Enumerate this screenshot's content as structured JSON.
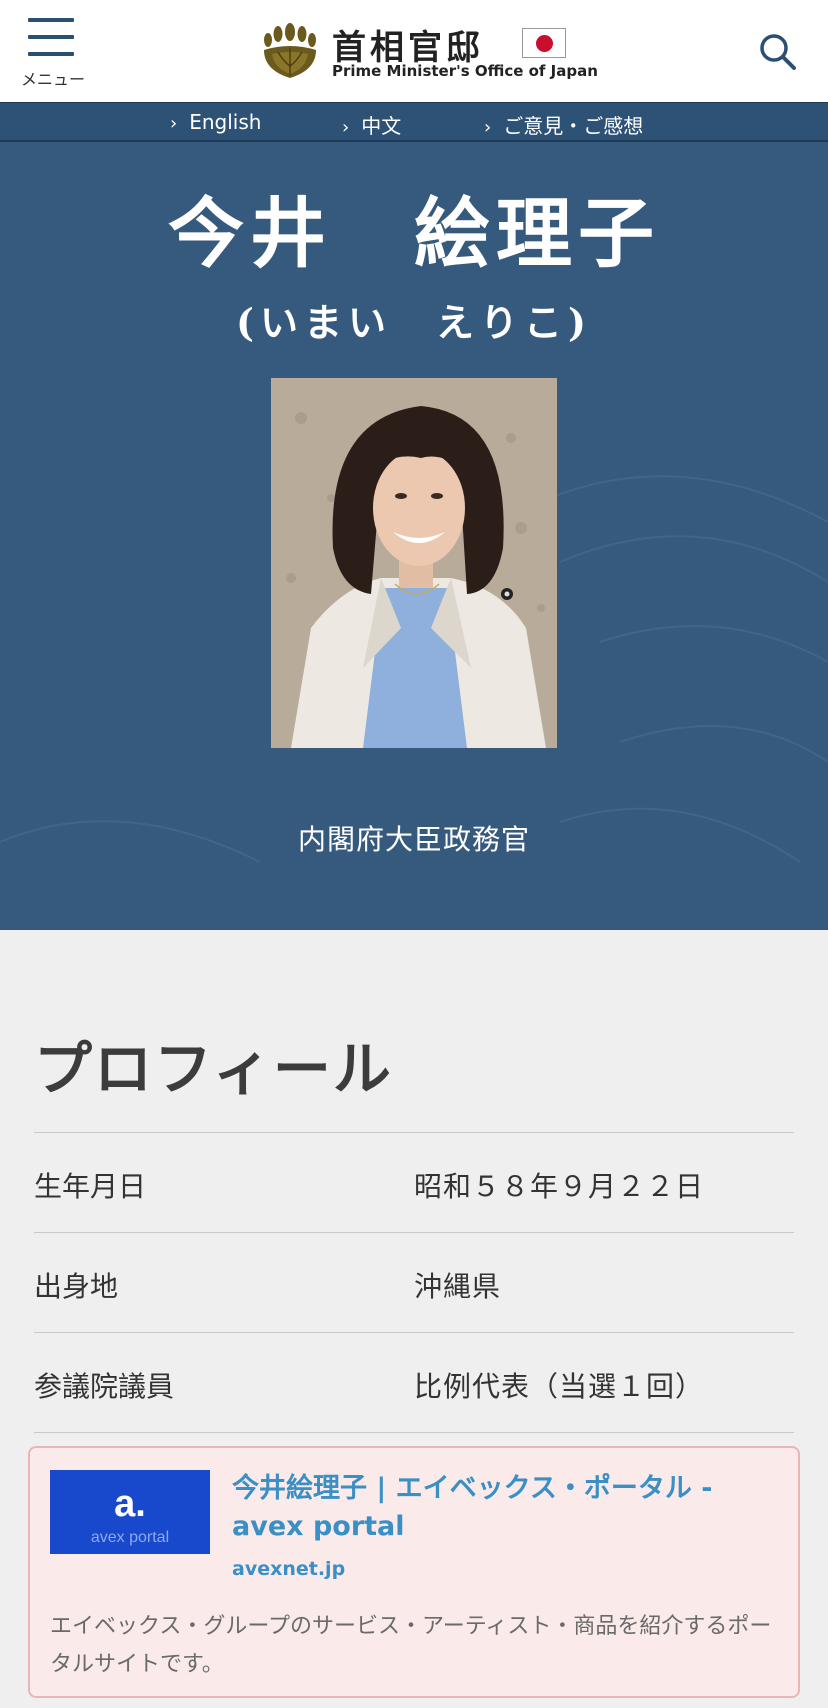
{
  "header": {
    "menu_label": "メニュー",
    "logo_jp": "首相官邸",
    "logo_en": "Prime Minister's Office of Japan"
  },
  "langbar": {
    "items": [
      {
        "label": "English"
      },
      {
        "label": "中文"
      },
      {
        "label": "ご意見・ご感想"
      }
    ]
  },
  "hero": {
    "name": "今井　絵理子",
    "kana": "(いまい　えりこ)",
    "position": "内閣府大臣政務官"
  },
  "profile": {
    "title": "プロフィール",
    "rows": [
      {
        "label": "生年月日",
        "value": "昭和５８年９月２２日"
      },
      {
        "label": "出身地",
        "value": "沖縄県"
      },
      {
        "label": "参議院議員",
        "value": "比例代表（当選１回）"
      }
    ]
  },
  "link_card": {
    "thumb_text": "avex portal",
    "title": "今井絵理子 | エイベックス・ポータル - avex portal",
    "domain": "avexnet.jp",
    "description": "エイベックス・グループのサービス・アーティスト・商品を紹介するポータルサイトです。"
  },
  "colors": {
    "navy": "#365a7e",
    "lang_bar": "#2d5276",
    "link_blue": "#3a8fc4",
    "card_bg": "#fbeaea",
    "flag_red": "#c8102e"
  }
}
